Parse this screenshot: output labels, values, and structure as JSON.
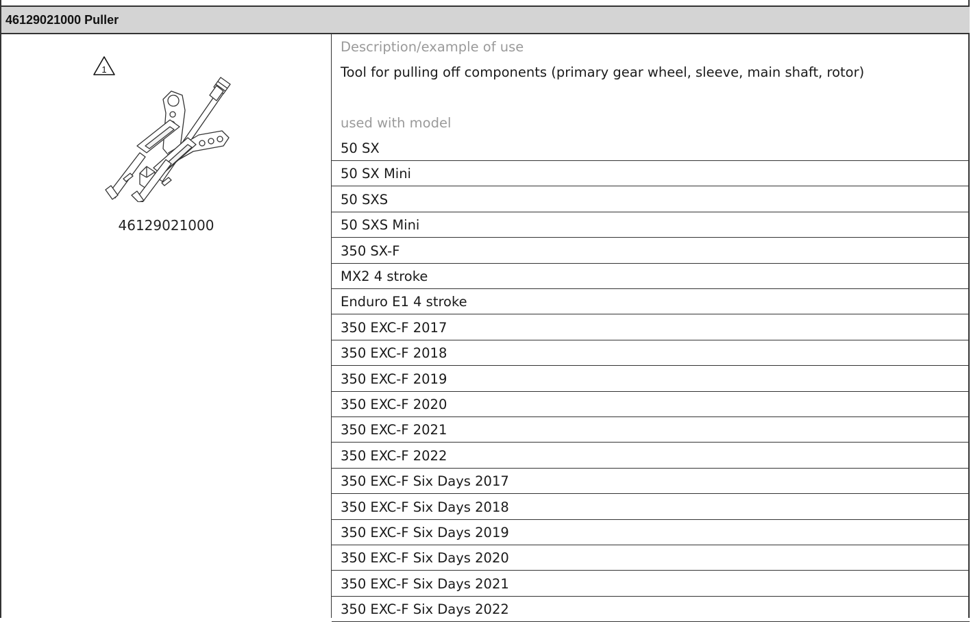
{
  "header": {
    "title": "46129021000 Puller"
  },
  "tool": {
    "image_icon": "puller-tool-drawing",
    "warning_icon": "warning-triangle-1-icon",
    "warning_number": "1",
    "code": "46129021000"
  },
  "description": {
    "label": "Description/example of use",
    "text": "Tool for pulling off components (primary gear wheel, sleeve, main shaft, rotor)"
  },
  "models": {
    "label": "used with model",
    "items": [
      "50 SX",
      "50 SX Mini",
      "50 SXS",
      "50 SXS Mini",
      "350 SX-F",
      "MX2 4 stroke",
      "Enduro E1 4 stroke",
      "350 EXC-F 2017",
      "350 EXC-F 2018",
      "350 EXC-F 2019",
      "350 EXC-F 2020",
      "350 EXC-F 2021",
      "350 EXC-F 2022",
      "350 EXC-F Six Days 2017",
      "350 EXC-F Six Days 2018",
      "350 EXC-F Six Days 2019",
      "350 EXC-F Six Days 2020",
      "350 EXC-F Six Days 2021",
      "350 EXC-F Six Days 2022"
    ]
  }
}
